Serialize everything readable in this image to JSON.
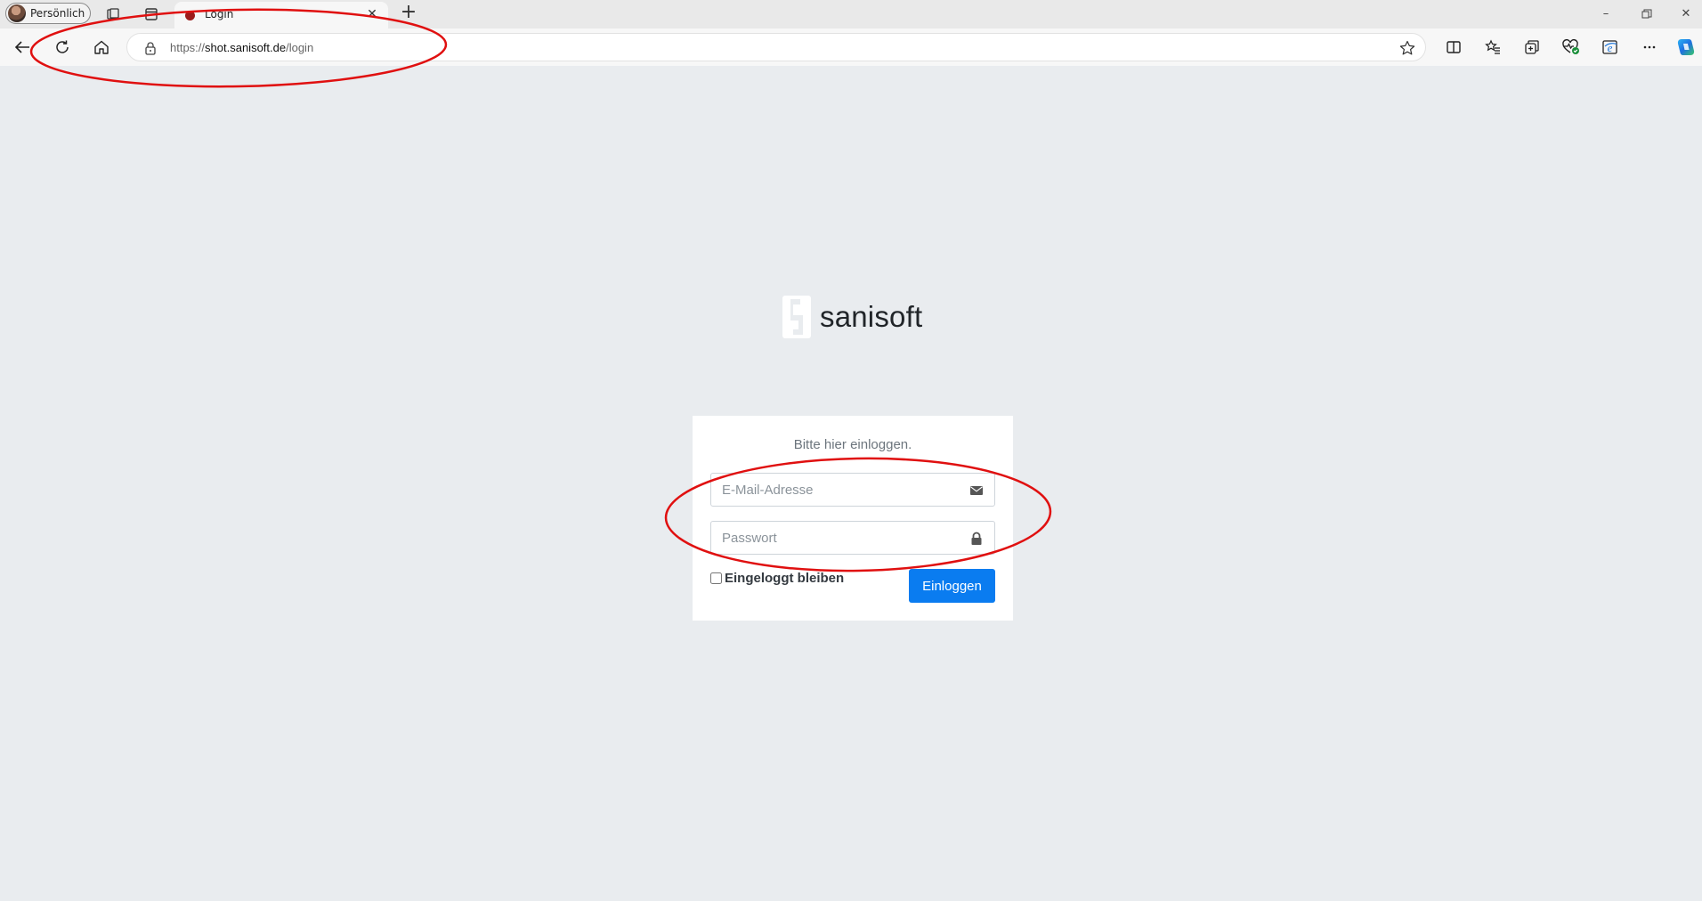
{
  "browser": {
    "profile_label": "Persönlich",
    "tab_title": "Login",
    "url_prefix": "https://",
    "url_host": "shot.sanisoft.de",
    "url_path": "/login"
  },
  "page": {
    "brand_name": "sanisoft",
    "login_message": "Bitte hier einloggen.",
    "email_placeholder": "E-Mail-Adresse",
    "password_placeholder": "Passwort",
    "remember_label": "Eingeloggt bleiben",
    "login_button": "Einloggen"
  },
  "colors": {
    "page_bg": "#e9ecef",
    "button_blue": "#0a7cf0",
    "annotation_red": "#e01010"
  }
}
